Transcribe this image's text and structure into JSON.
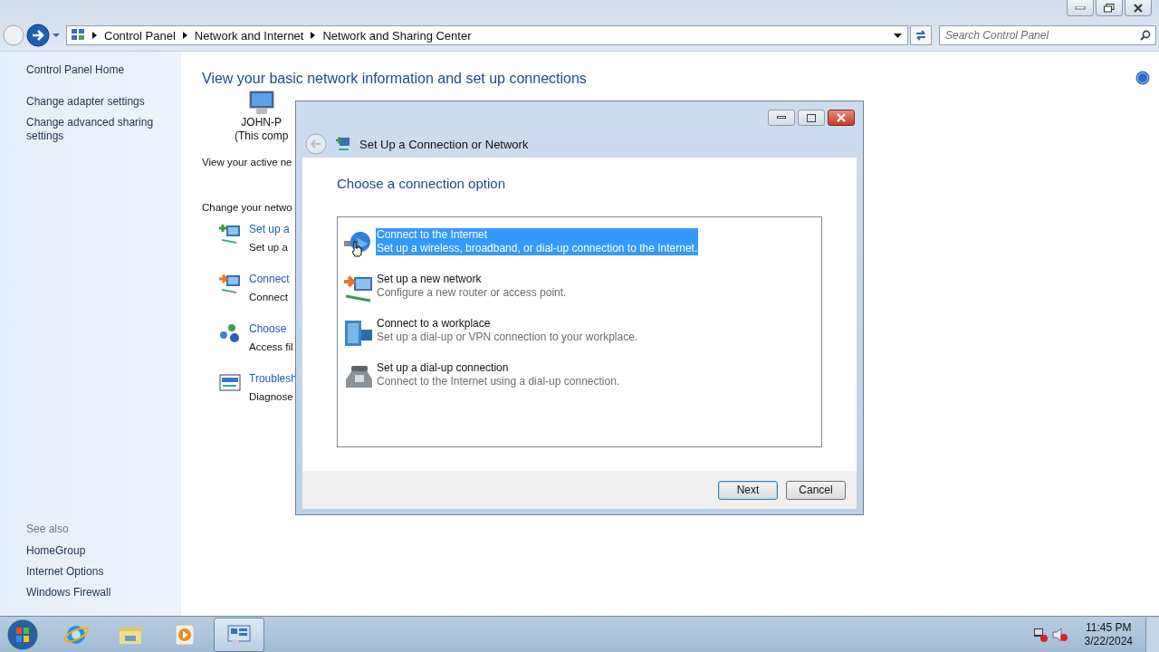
{
  "explorer": {
    "breadcrumb": [
      "Control Panel",
      "Network and Internet",
      "Network and Sharing Center"
    ],
    "search": {
      "placeholder": "Search Control Panel"
    }
  },
  "sidebar": {
    "links": [
      "Control Panel Home",
      "Change adapter settings",
      "Change advanced sharing settings"
    ],
    "see_also_title": "See also",
    "see_also": [
      "HomeGroup",
      "Internet Options",
      "Windows Firewall"
    ]
  },
  "main": {
    "heading": "View your basic network information and set up connections",
    "computer_name": "JOHN-P",
    "computer_caption": "(This comp",
    "active_networks_label": "View your active ne",
    "change_settings_label": "Change your netwo",
    "tasks": [
      {
        "kind": "new",
        "title": "Set up a",
        "description": "Set up a"
      },
      {
        "kind": "connect",
        "title": "Connect",
        "description": "Connect"
      },
      {
        "kind": "homegroup",
        "title": "Choose",
        "description": "Access fil"
      },
      {
        "kind": "troubleshoot",
        "title": "Troublesh",
        "description": "Diagnose"
      }
    ]
  },
  "dialog": {
    "title": "Set Up a Connection or Network",
    "heading": "Choose a connection option",
    "options": [
      {
        "kind": "globe",
        "title": "Connect to the Internet",
        "description": "Set up a wireless, broadband, or dial-up connection to the Internet.",
        "selected": true
      },
      {
        "kind": "network",
        "title": "Set up a new network",
        "description": "Configure a new router or access point.",
        "selected": false
      },
      {
        "kind": "workplace",
        "title": "Connect to a workplace",
        "description": "Set up a dial-up or VPN connection to your workplace.",
        "selected": false
      },
      {
        "kind": "phone",
        "title": "Set up a dial-up connection",
        "description": "Connect to the Internet using a dial-up connection.",
        "selected": false
      }
    ],
    "buttons": [
      {
        "label": "Next",
        "default": true
      },
      {
        "label": "Cancel",
        "default": false
      }
    ]
  },
  "taskbar": {
    "apps": [
      {
        "kind": "ie",
        "active": false
      },
      {
        "kind": "folder",
        "active": false
      },
      {
        "kind": "media",
        "active": false
      },
      {
        "kind": "control",
        "active": true
      }
    ],
    "time": "11:45 PM",
    "date": "3/22/2024"
  }
}
